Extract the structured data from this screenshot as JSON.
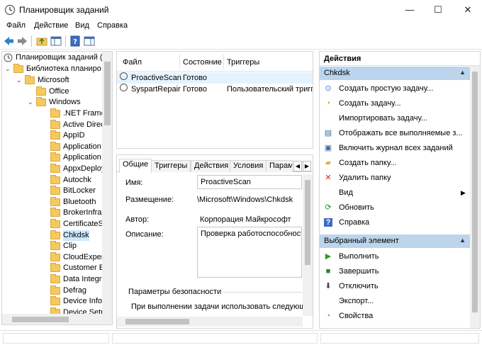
{
  "window": {
    "title": "Планировщик заданий",
    "controls": {
      "minimize": "—",
      "maximize": "☐",
      "close": "✕"
    }
  },
  "menu": [
    "Файл",
    "Действие",
    "Вид",
    "Справка"
  ],
  "toolbar": {
    "icons": [
      "back-arrow-icon",
      "forward-arrow-icon",
      "up-folder-icon",
      "show-hide-console-tree-icon",
      "help-icon",
      "action-pane-icon"
    ]
  },
  "tree": {
    "root": "Планировщик заданий (",
    "library": "Библиотека планиро",
    "microsoft": "Microsoft",
    "office": "Office",
    "windows": "Windows",
    "items": [
      ".NET Frame",
      "Active Direc",
      "AppID",
      "Application",
      "Application",
      "AppxDeploy",
      "Autochk",
      "BitLocker",
      "Bluetooth",
      "BrokerInfras",
      "CertificateS",
      "Chkdsk",
      "Clip",
      "CloudExper",
      "Customer E",
      "Data Integri",
      "Defrag",
      "Device Info",
      "Device Setu"
    ],
    "selected": "Chkdsk"
  },
  "task_list": {
    "columns": [
      "Файл",
      "Состояние",
      "Триггеры"
    ],
    "rows": [
      {
        "name": "ProactiveScan",
        "status": "Готово",
        "triggers": ""
      },
      {
        "name": "SyspartRepair",
        "status": "Готово",
        "triggers": "Пользовательский тригге"
      }
    ]
  },
  "details": {
    "tabs": [
      "Общие",
      "Триггеры",
      "Действия",
      "Условия",
      "Парам"
    ],
    "active_tab": "Общие",
    "name_label": "Имя:",
    "name_value": "ProactiveScan",
    "location_label": "Размещение:",
    "location_value": "\\Microsoft\\Windows\\Chkdsk",
    "author_label": "Автор:",
    "author_value": "Корпорация Майкрософт",
    "description_label": "Описание:",
    "description_value": "Проверка работоспособност",
    "security_group": "Параметры безопасности",
    "security_text": "При выполнении задачи использовать следующу"
  },
  "actions": {
    "title": "Действия",
    "section1": "Chkdsk",
    "section1_items": [
      {
        "label": "Создать простую задачу...",
        "icon": "create-basic-task-icon"
      },
      {
        "label": "Создать задачу...",
        "icon": "create-task-icon"
      },
      {
        "label": "Импортировать задачу...",
        "icon": ""
      },
      {
        "label": "Отображать все выполняемые з...",
        "icon": "display-running-tasks-icon"
      },
      {
        "label": "Включить журнал всех заданий",
        "icon": "enable-history-icon"
      },
      {
        "label": "Создать папку...",
        "icon": "new-folder-icon"
      },
      {
        "label": "Удалить папку",
        "icon": "delete-folder-icon"
      },
      {
        "label": "Вид",
        "icon": ""
      },
      {
        "label": "Обновить",
        "icon": "refresh-icon"
      },
      {
        "label": "Справка",
        "icon": "help-icon"
      }
    ],
    "section2": "Выбранный элемент",
    "section2_items": [
      {
        "label": "Выполнить",
        "icon": "run-icon"
      },
      {
        "label": "Завершить",
        "icon": "end-icon"
      },
      {
        "label": "Отключить",
        "icon": "disable-icon"
      },
      {
        "label": "Экспорт...",
        "icon": ""
      },
      {
        "label": "Свойства",
        "icon": "properties-icon"
      }
    ]
  }
}
